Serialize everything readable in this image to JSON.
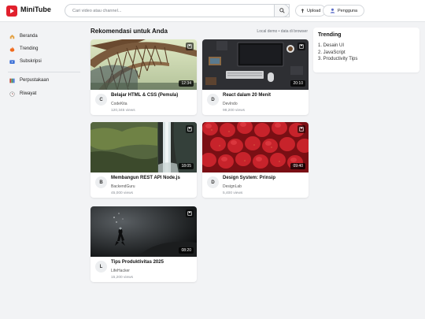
{
  "header": {
    "brand": "MiniTube",
    "search_placeholder": "Cari video atau channel...",
    "upload_label": "Upload",
    "user_label": "Pengguna"
  },
  "sidebar": {
    "items": [
      {
        "label": "Beranda",
        "icon": "home-icon"
      },
      {
        "label": "Trending",
        "icon": "fire-icon"
      },
      {
        "label": "Subskripsi",
        "icon": "subscriptions-icon"
      },
      {
        "label": "Perpustakaan",
        "icon": "library-icon"
      },
      {
        "label": "Riwayat",
        "icon": "history-icon"
      }
    ]
  },
  "main": {
    "title": "Rekomendasi untuk Anda",
    "note": "Local demo • data di browser",
    "videos": [
      {
        "title": "Belajar HTML & CSS (Pemula)",
        "channel": "CodeKita",
        "views": "120,345 views",
        "duration": "12:34",
        "avatar": "C",
        "thumb": "bridge"
      },
      {
        "title": "React dalam 20 Menit",
        "channel": "DevIndo",
        "views": "98,200 views",
        "duration": "20:10",
        "avatar": "D",
        "thumb": "desk"
      },
      {
        "title": "Membangun REST API Node.js",
        "channel": "BackendGuru",
        "views": "45,000 views",
        "duration": "18:05",
        "avatar": "B",
        "thumb": "waterfall"
      },
      {
        "title": "Design System: Prinsip",
        "channel": "DesignLab",
        "views": "5,400 views",
        "duration": "09:40",
        "avatar": "D",
        "thumb": "strawberries"
      },
      {
        "title": "Tips Produktivitas 2025",
        "channel": "LifeHacker",
        "views": "15,200 views",
        "duration": "08:20",
        "avatar": "L",
        "thumb": "diver"
      }
    ]
  },
  "trending": {
    "title": "Trending",
    "items": [
      "1. Desain UI",
      "2. JavaScript",
      "3. Productivity Tips"
    ]
  },
  "colors": {
    "brand_red": "#e1202d",
    "page_bg": "#f2f3f5"
  }
}
